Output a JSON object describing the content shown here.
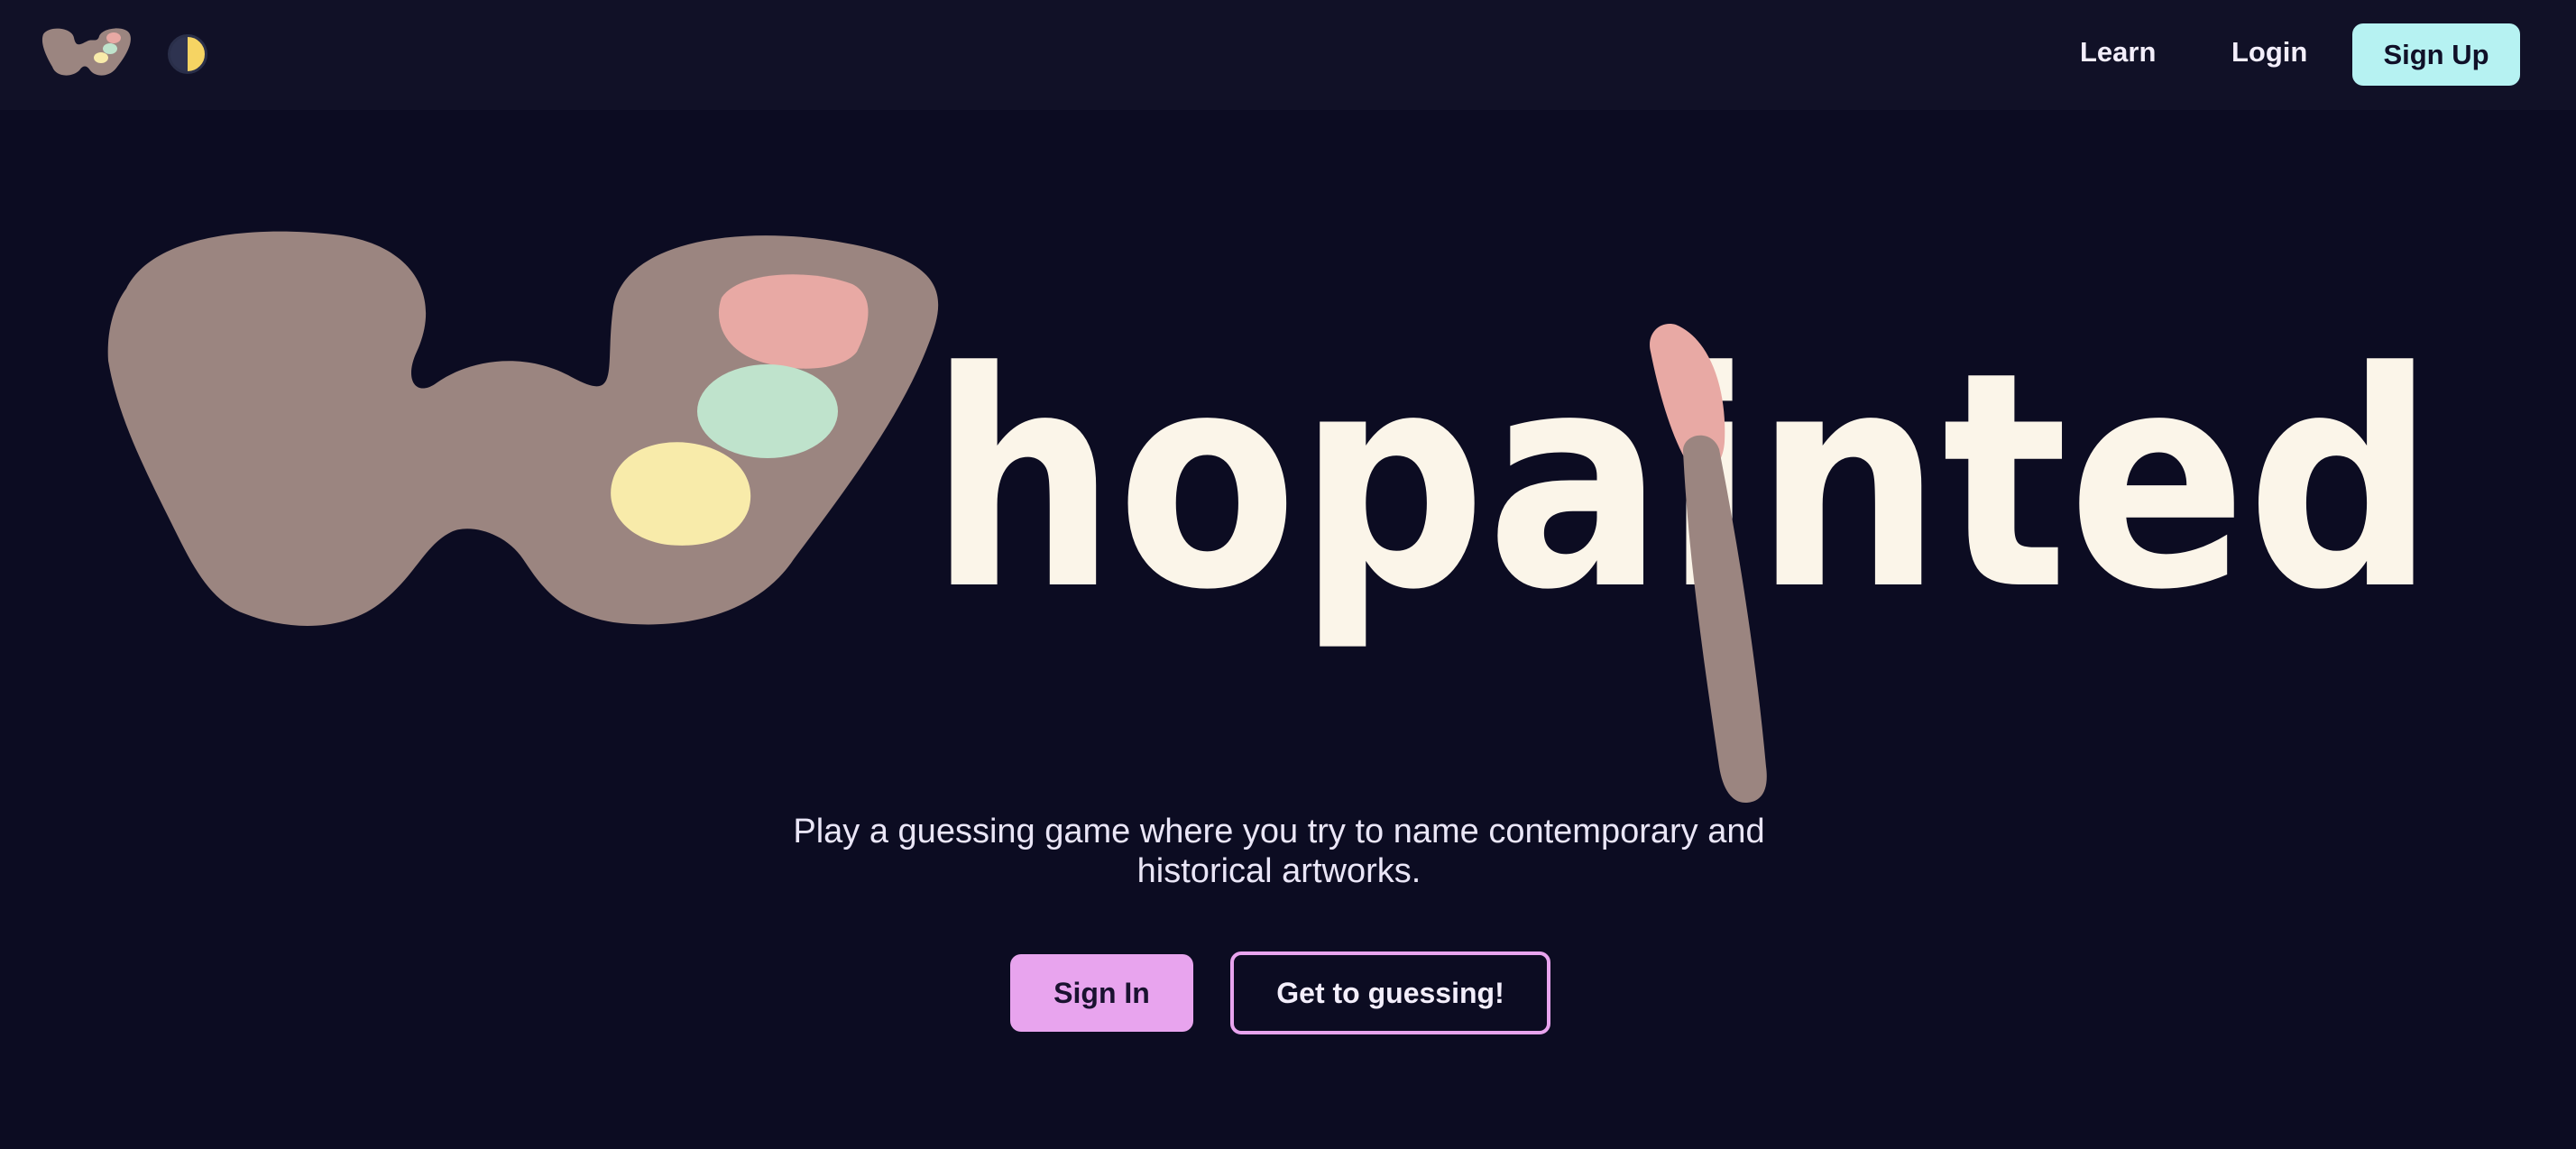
{
  "nav": {
    "learn_label": "Learn",
    "login_label": "Login",
    "signup_label": "Sign Up"
  },
  "hero": {
    "title_text": "hopainted",
    "tagline": "Play a guessing game where you try to name contemporary and historical artworks."
  },
  "actions": {
    "signin_label": "Sign In",
    "guess_label": "Get to guessing!"
  },
  "icons": {
    "logo": "palette-w-logo",
    "theme": "half-moon-icon",
    "brush": "paintbrush-icon"
  },
  "colors": {
    "background": "#0c0c22",
    "topbar": "#111127",
    "palette": "#9b8580",
    "paint_pink": "#e8a9a4",
    "paint_green": "#bfe3cc",
    "paint_yellow": "#f8ebaa",
    "title_text": "#fbf5e9",
    "signup_bg": "#b6f2f2",
    "accent_pink": "#e8a4ee"
  }
}
